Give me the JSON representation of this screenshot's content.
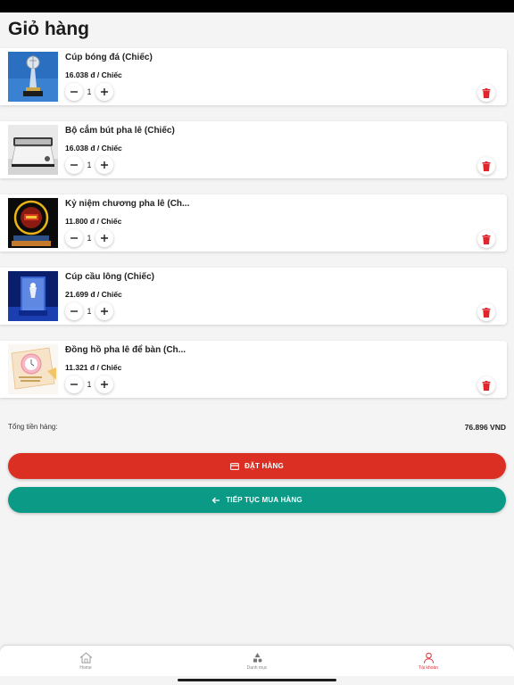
{
  "page": {
    "title": "Giỏ hàng"
  },
  "cart": {
    "items": [
      {
        "name": "Cúp bóng đá (Chiếc)",
        "price": "16.038 đ / Chiếc",
        "quantity": "1",
        "image": "soccer-trophy-image"
      },
      {
        "name": "Bộ cắm bút pha lê (Chiếc)",
        "price": "16.038 đ / Chiếc",
        "quantity": "1",
        "image": "crystal-pen-holder-image"
      },
      {
        "name": "Kỷ niệm chương pha lê (Ch...",
        "price": "11.800 đ / Chiếc",
        "quantity": "1",
        "image": "crystal-plaque-image"
      },
      {
        "name": "Cúp cầu lông (Chiếc)",
        "price": "21.699 đ / Chiếc",
        "quantity": "1",
        "image": "badminton-trophy-image"
      },
      {
        "name": "Đồng hồ pha lê để bàn (Ch...",
        "price": "11.321 đ / Chiếc",
        "quantity": "1",
        "image": "crystal-desk-clock-image"
      }
    ]
  },
  "summary": {
    "total_label": "Tổng tiền hàng:",
    "total_value": "76.896 VND"
  },
  "actions": {
    "order_label": "ĐẶT HÀNG",
    "order_icon": "credit-card-icon",
    "continue_label": "TIẾP TỤC MUA HÀNG",
    "continue_icon": "arrow-left-icon"
  },
  "tab_bar": {
    "tabs": [
      {
        "label": "Home",
        "icon": "home-icon"
      },
      {
        "label": "Danh mục",
        "icon": "category-icon"
      },
      {
        "label": "Tài khoản",
        "icon": "user-icon"
      }
    ],
    "active_tab": "Tài khoản"
  },
  "colors": {
    "order_button": "#dc2f23",
    "continue_button": "#0a9a86",
    "delete_icon": "#e0262a",
    "active_tab": "#e0303a"
  }
}
